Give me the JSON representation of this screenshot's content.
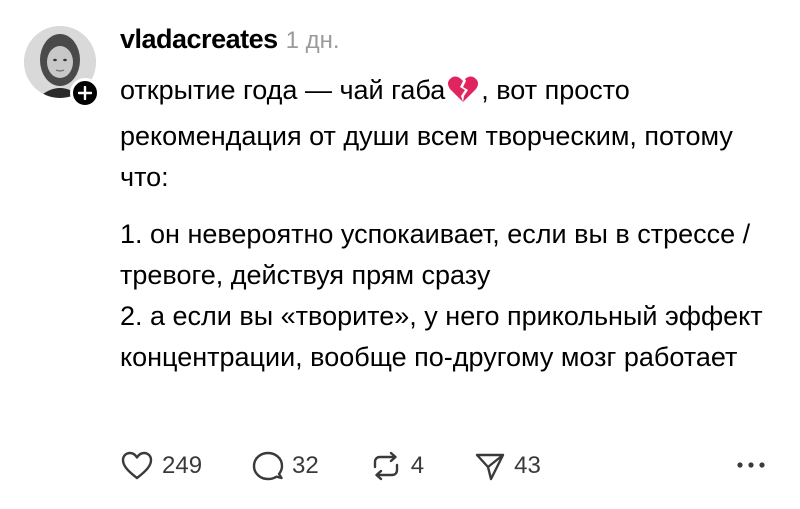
{
  "post": {
    "author": {
      "username": "vladacreates",
      "timestamp": "1 дн.",
      "avatar_icon": "avatar-portrait",
      "follow_icon": "plus-icon"
    },
    "text": {
      "line1_before_emoji": "открытие года — чай габа",
      "emoji": "broken-heart",
      "line1_after_emoji": ", вот просто рекомендация от души всем творческим, потому что:",
      "point1": "1. он невероятно успокаивает, если вы в стрессе / тревоге, действуя прям сразу",
      "point2": "2. а если вы «творите», у него прикольный эффект концентрации, вообще по-другому мозг работает"
    },
    "actions": {
      "likes": "249",
      "comments": "32",
      "reposts": "4",
      "shares": "43"
    },
    "colors": {
      "text": "#000000",
      "muted": "#9a9a9a",
      "heart_red": "#e0245e"
    }
  }
}
